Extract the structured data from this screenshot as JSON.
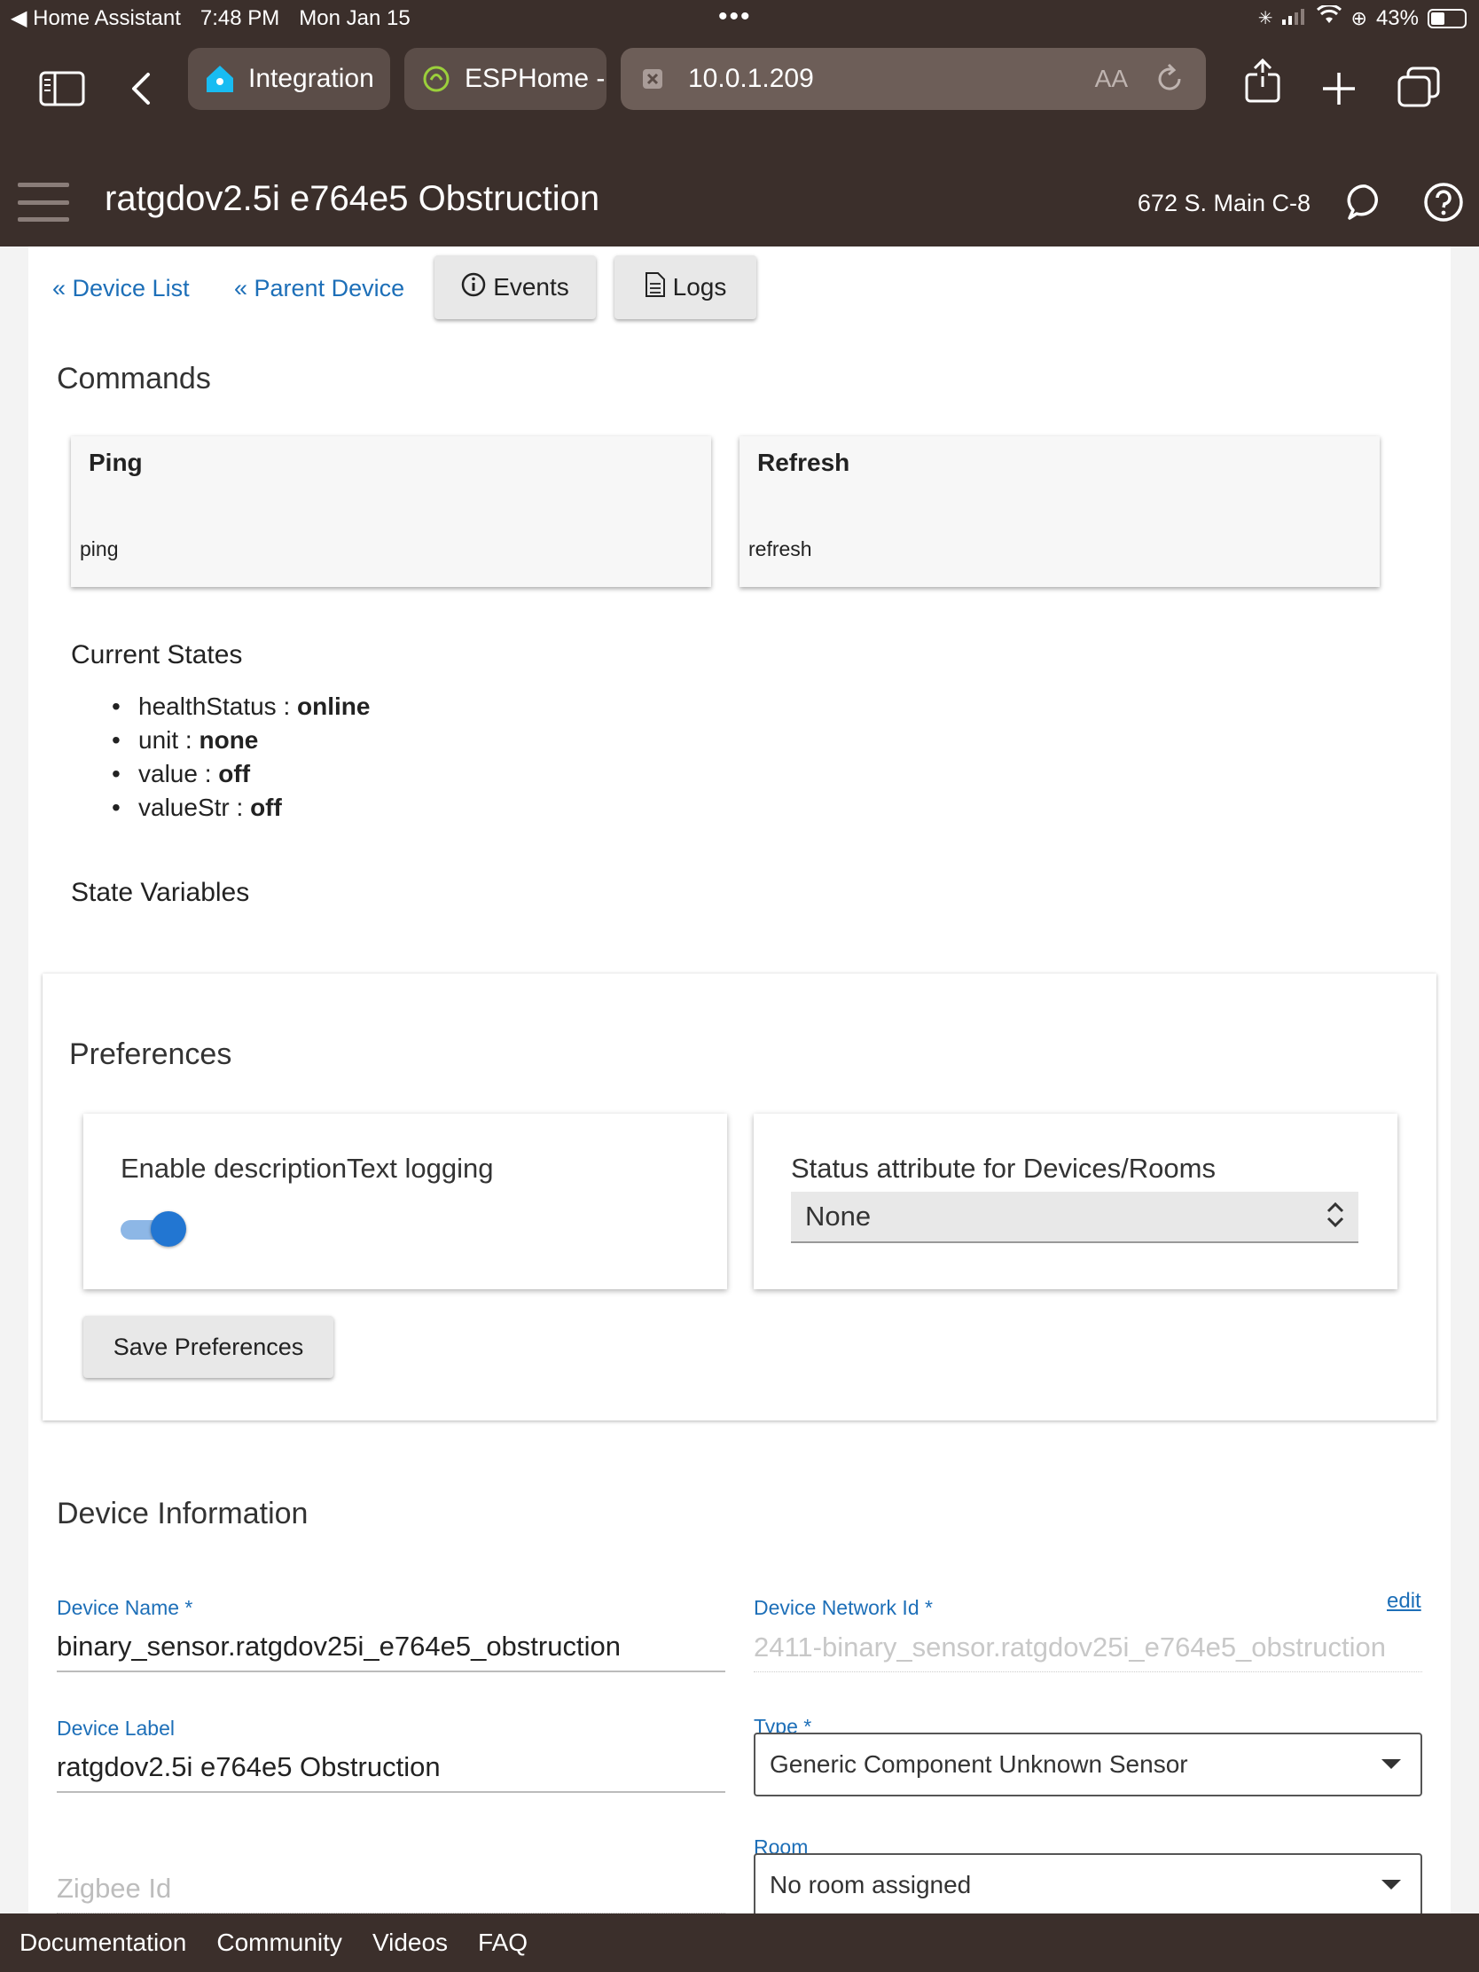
{
  "status_bar": {
    "back_app": "Home Assistant",
    "time": "7:48 PM",
    "date": "Mon Jan 15",
    "dots": "•••",
    "battery": "43%",
    "battery_level": 0.43
  },
  "browser": {
    "tabs": [
      {
        "label": "Integration"
      },
      {
        "label": "ESPHome -"
      },
      {
        "label": "10.0.1.209"
      }
    ],
    "text_size_label": "AA"
  },
  "header": {
    "title": "ratgdov2.5i e764e5 Obstruction",
    "location": "672 S. Main C-8"
  },
  "nav": {
    "device_list": "« Device List",
    "parent_device": "« Parent Device",
    "events": "Events",
    "logs": "Logs"
  },
  "commands": {
    "title": "Commands",
    "items": [
      {
        "name": "Ping",
        "method": "ping"
      },
      {
        "name": "Refresh",
        "method": "refresh"
      }
    ]
  },
  "current_states": {
    "title": "Current States",
    "items": [
      {
        "key": "healthStatus : ",
        "value": "online"
      },
      {
        "key": "unit : ",
        "value": "none"
      },
      {
        "key": "value : ",
        "value": "off"
      },
      {
        "key": "valueStr : ",
        "value": "off"
      }
    ]
  },
  "state_variables": {
    "title": "State Variables"
  },
  "preferences": {
    "title": "Preferences",
    "logging_label": "Enable descriptionText logging",
    "logging_enabled": true,
    "status_attr_label": "Status attribute for Devices/Rooms",
    "status_attr_value": "None",
    "save_label": "Save Preferences"
  },
  "device_info": {
    "title": "Device Information",
    "device_name_label": "Device Name *",
    "device_name": "binary_sensor.ratgdov25i_e764e5_obstruction",
    "network_id_label": "Device Network Id *",
    "network_id": "2411-binary_sensor.ratgdov25i_e764e5_obstruction",
    "edit_label": "edit",
    "device_label_label": "Device Label",
    "device_label": "ratgdov2.5i e764e5 Obstruction",
    "type_label": "Type *",
    "type_value": "Generic Component Unknown Sensor",
    "room_label": "Room",
    "room_value": "No room assigned",
    "zigbee_placeholder": "Zigbee Id"
  },
  "footer": {
    "links": [
      "Documentation",
      "Community",
      "Videos",
      "FAQ"
    ]
  }
}
